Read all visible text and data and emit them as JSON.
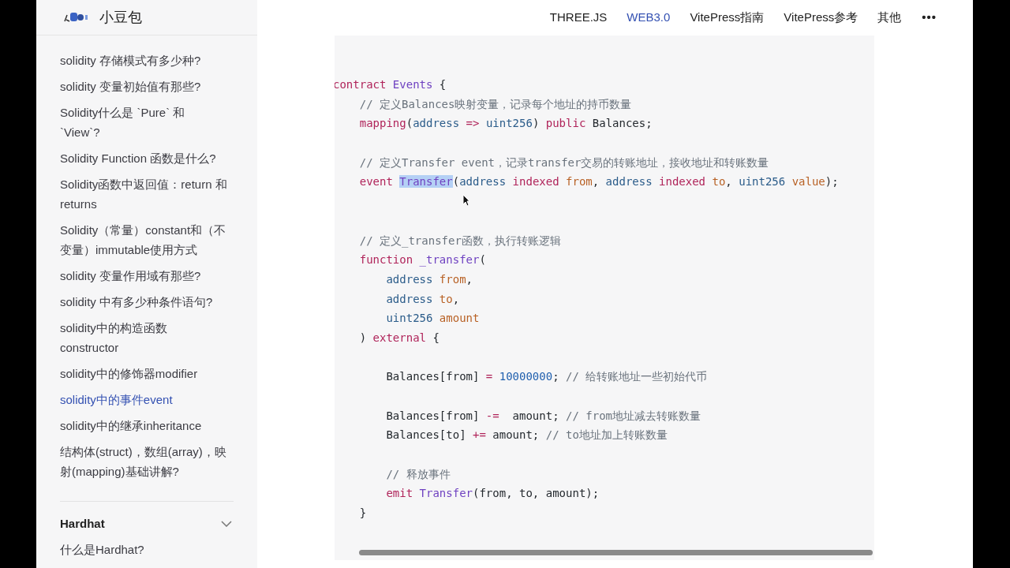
{
  "site": {
    "title": "小豆包"
  },
  "nav": [
    {
      "label": "THREE.JS",
      "selected": false
    },
    {
      "label": "WEB3.0",
      "selected": true
    },
    {
      "label": "VitePress指南",
      "selected": false
    },
    {
      "label": "VitePress参考",
      "selected": false
    },
    {
      "label": "其他",
      "selected": false
    },
    {
      "label": "•••",
      "selected": false
    }
  ],
  "sidebar": {
    "items": [
      {
        "label": "solidity 存储模式有多少种?",
        "selected": false
      },
      {
        "label": "solidity 变量初始值有那些?",
        "selected": false
      },
      {
        "label": "Solidity什么是 `Pure` 和 `View`?",
        "selected": false
      },
      {
        "label": "Solidity Function 函数是什么?",
        "selected": false
      },
      {
        "label": "Solidity函数中返回值：return 和 returns",
        "selected": false
      },
      {
        "label": "Solidity（常量）constant和（不变量）immutable使用方式",
        "selected": false
      },
      {
        "label": "solidity 变量作用域有那些?",
        "selected": false
      },
      {
        "label": "solidity 中有多少种条件语句?",
        "selected": false
      },
      {
        "label": "solidity中的构造函数 constructor",
        "selected": false
      },
      {
        "label": "solidity中的修饰器modifier",
        "selected": false
      },
      {
        "label": "solidity中的事件event",
        "selected": true
      },
      {
        "label": "solidity中的继承inheritance",
        "selected": false
      },
      {
        "label": "结构体(struct)，数组(array)，映射(mapping)基础讲解?",
        "selected": false
      }
    ],
    "section": {
      "title": "Hardhat",
      "expanded": true,
      "items": [
        {
          "label": "什么是Hardhat?",
          "selected": false
        }
      ]
    }
  },
  "code": [
    {
      "kind": "line",
      "tokens": [
        {
          "t": "contract ",
          "kind": "keyword"
        },
        {
          "t": "Events",
          "kind": "name"
        },
        {
          "t": " {",
          "kind": "plain"
        }
      ],
      "children": [
        {
          "kind": "line",
          "tokens": [
            {
              "t": "// 定义Balances映射变量，记录每个地址的持币数量",
              "kind": "comment"
            }
          ]
        },
        {
          "kind": "line",
          "tokens": [
            {
              "t": "mapping",
              "kind": "keyword"
            },
            {
              "t": "(",
              "kind": "plain"
            },
            {
              "t": "address ",
              "kind": "type"
            },
            {
              "t": "=> ",
              "kind": "keyword"
            },
            {
              "t": "uint256",
              "kind": "type"
            },
            {
              "t": ") ",
              "kind": "plain"
            },
            {
              "t": "public",
              "kind": "keyword"
            },
            {
              "t": " Balances;",
              "kind": "plain"
            }
          ]
        },
        {
          "kind": "blank"
        },
        {
          "kind": "line",
          "tokens": [
            {
              "t": "// 定义Transfer event，记录transfer交易的转账地址，接收地址和转账数量",
              "kind": "comment"
            }
          ]
        },
        {
          "kind": "line",
          "tokens": [
            {
              "t": "event ",
              "kind": "keyword"
            },
            {
              "t": "Transfer",
              "kind": "name",
              "highlighted": true
            },
            {
              "t": "(",
              "kind": "plain"
            },
            {
              "t": "address ",
              "kind": "type"
            },
            {
              "t": "indexed ",
              "kind": "keyword"
            },
            {
              "t": "from",
              "kind": "param"
            },
            {
              "t": ", ",
              "kind": "plain"
            },
            {
              "t": "address ",
              "kind": "type"
            },
            {
              "t": "indexed ",
              "kind": "keyword"
            },
            {
              "t": "to",
              "kind": "param"
            },
            {
              "t": ", ",
              "kind": "plain"
            },
            {
              "t": "uint256 ",
              "kind": "type"
            },
            {
              "t": "value",
              "kind": "param"
            },
            {
              "t": ");",
              "kind": "plain"
            }
          ]
        },
        {
          "kind": "blank"
        },
        {
          "kind": "blank"
        },
        {
          "kind": "line",
          "tokens": [
            {
              "t": "// 定义_transfer函数，执行转账逻辑",
              "kind": "comment"
            }
          ]
        },
        {
          "kind": "line",
          "tokens": [
            {
              "t": "function ",
              "kind": "keyword"
            },
            {
              "t": "_transfer",
              "kind": "name"
            },
            {
              "t": "(",
              "kind": "plain"
            }
          ],
          "children": [
            {
              "kind": "line",
              "tokens": [
                {
                  "t": "address ",
                  "kind": "type"
                },
                {
                  "t": "from",
                  "kind": "param"
                },
                {
                  "t": ",",
                  "kind": "plain"
                }
              ]
            },
            {
              "kind": "line",
              "tokens": [
                {
                  "t": "address ",
                  "kind": "type"
                },
                {
                  "t": "to",
                  "kind": "param"
                },
                {
                  "t": ",",
                  "kind": "plain"
                }
              ]
            },
            {
              "kind": "line",
              "tokens": [
                {
                  "t": "uint256 ",
                  "kind": "type"
                },
                {
                  "t": "amount",
                  "kind": "param"
                }
              ]
            }
          ]
        },
        {
          "kind": "line",
          "tokens": [
            {
              "t": ") ",
              "kind": "plain"
            },
            {
              "t": "external",
              "kind": "keyword"
            },
            {
              "t": " {",
              "kind": "plain"
            }
          ],
          "children": [
            {
              "kind": "blank"
            },
            {
              "kind": "line",
              "tokens": [
                {
                  "t": "Balances[from] ",
                  "kind": "plain"
                },
                {
                  "t": "= ",
                  "kind": "keyword"
                },
                {
                  "t": "10000000",
                  "kind": "number"
                },
                {
                  "t": "; ",
                  "kind": "plain"
                },
                {
                  "t": "// 给转账地址一些初始代币",
                  "kind": "comment"
                }
              ]
            },
            {
              "kind": "blank"
            },
            {
              "kind": "line",
              "tokens": [
                {
                  "t": "Balances[from] ",
                  "kind": "plain"
                },
                {
                  "t": "-=",
                  "kind": "keyword"
                },
                {
                  "t": "  amount; ",
                  "kind": "plain"
                },
                {
                  "t": "// from地址减去转账数量",
                  "kind": "comment"
                }
              ]
            },
            {
              "kind": "line",
              "tokens": [
                {
                  "t": "Balances[to] ",
                  "kind": "plain"
                },
                {
                  "t": "+=",
                  "kind": "keyword"
                },
                {
                  "t": " amount; ",
                  "kind": "plain"
                },
                {
                  "t": "// to地址加上转账数量",
                  "kind": "comment"
                }
              ]
            },
            {
              "kind": "blank"
            },
            {
              "kind": "line",
              "tokens": [
                {
                  "t": "// 释放事件",
                  "kind": "comment"
                }
              ]
            },
            {
              "kind": "line",
              "tokens": [
                {
                  "t": "emit ",
                  "kind": "keyword"
                },
                {
                  "t": "Transfer",
                  "kind": "name"
                },
                {
                  "t": "(from, to, amount);",
                  "kind": "plain"
                }
              ]
            }
          ]
        },
        {
          "kind": "line",
          "tokens": [
            {
              "t": "}",
              "kind": "plain"
            }
          ]
        }
      ]
    }
  ]
}
